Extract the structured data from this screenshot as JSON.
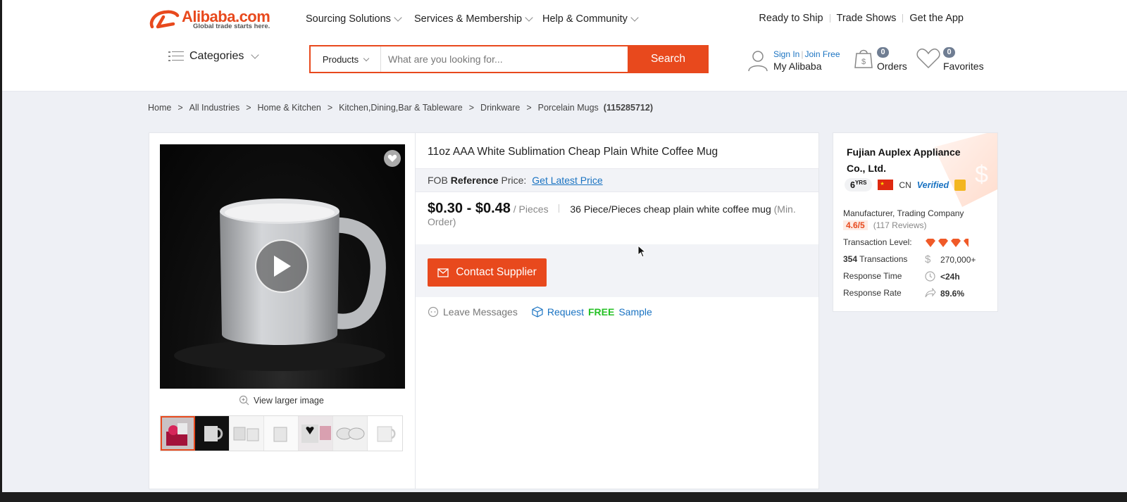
{
  "header": {
    "logo_text": "Alibaba.com",
    "logo_tagline": "Global trade starts here.",
    "nav": [
      {
        "label": "Sourcing Solutions"
      },
      {
        "label": "Services & Membership"
      },
      {
        "label": "Help & Community"
      }
    ],
    "top_links": [
      {
        "label": "Ready to Ship"
      },
      {
        "label": "Trade Shows"
      },
      {
        "label": "Get the App"
      }
    ],
    "categories_label": "Categories",
    "search": {
      "category": "Products",
      "placeholder": "What are you looking for...",
      "button": "Search"
    },
    "account": {
      "sign_in": "Sign In",
      "join_free": "Join Free",
      "my_alibaba": "My Alibaba"
    },
    "orders": {
      "count": "0",
      "label": "Orders"
    },
    "favorites": {
      "count": "0",
      "label": "Favorites"
    }
  },
  "breadcrumb": {
    "items": [
      "Home",
      "All Industries",
      "Home & Kitchen",
      "Kitchen,Dining,Bar & Tableware",
      "Drinkware",
      "Porcelain Mugs"
    ],
    "count": "(115285712)"
  },
  "product": {
    "view_larger": "View larger image",
    "title": "11oz AAA White Sublimation Cheap Plain White Coffee Mug",
    "fob_prefix": "FOB",
    "fob_reference": "Reference",
    "fob_price_label": "Price:",
    "latest_price_link": "Get Latest Price",
    "price_range": "$0.30 - $0.48",
    "price_unit": "/ Pieces",
    "min_order": "36 Piece/Pieces cheap plain white coffee mug",
    "min_order_note": "(Min. Order)",
    "contact_button": "Contact Supplier",
    "leave_messages": "Leave Messages",
    "sample_request": "Request",
    "sample_free": "FREE",
    "sample_word": "Sample"
  },
  "supplier": {
    "name": "Fujian Auplex Appliance Co., Ltd.",
    "years": "6",
    "years_unit": "YRS",
    "country": "CN",
    "verified": "Verified",
    "type": "Manufacturer, Trading Company",
    "rating": "4.6/5",
    "reviews": "(117 Reviews)",
    "transaction_level_label": "Transaction Level:",
    "transactions_count": "354",
    "transactions_label": "Transactions",
    "transactions_value": "270,000+",
    "response_time_label": "Response Time",
    "response_time_value": "<24h",
    "response_rate_label": "Response Rate",
    "response_rate_value": "89.6%"
  },
  "colors": {
    "brand_orange": "#e8491d",
    "link_blue": "#1a73c2",
    "free_green": "#25c125"
  }
}
